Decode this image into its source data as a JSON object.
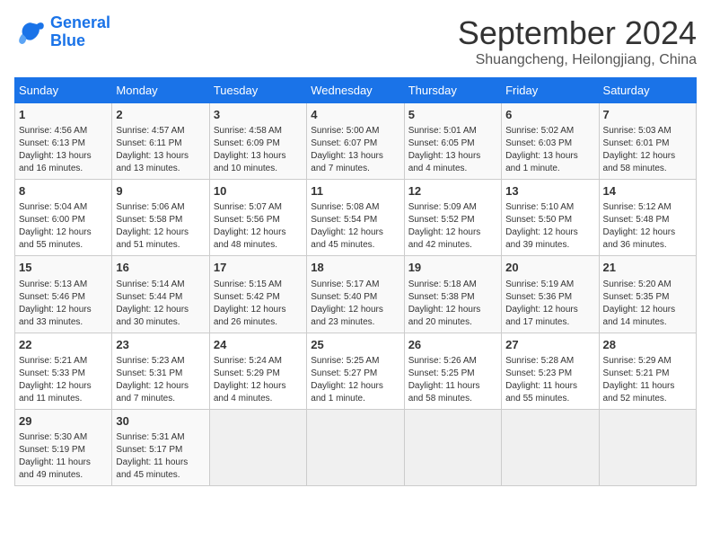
{
  "logo": {
    "line1": "General",
    "line2": "Blue"
  },
  "title": "September 2024",
  "subtitle": "Shuangcheng, Heilongjiang, China",
  "weekdays": [
    "Sunday",
    "Monday",
    "Tuesday",
    "Wednesday",
    "Thursday",
    "Friday",
    "Saturday"
  ],
  "weeks": [
    [
      {
        "day": "1",
        "info": "Sunrise: 4:56 AM\nSunset: 6:13 PM\nDaylight: 13 hours\nand 16 minutes."
      },
      {
        "day": "2",
        "info": "Sunrise: 4:57 AM\nSunset: 6:11 PM\nDaylight: 13 hours\nand 13 minutes."
      },
      {
        "day": "3",
        "info": "Sunrise: 4:58 AM\nSunset: 6:09 PM\nDaylight: 13 hours\nand 10 minutes."
      },
      {
        "day": "4",
        "info": "Sunrise: 5:00 AM\nSunset: 6:07 PM\nDaylight: 13 hours\nand 7 minutes."
      },
      {
        "day": "5",
        "info": "Sunrise: 5:01 AM\nSunset: 6:05 PM\nDaylight: 13 hours\nand 4 minutes."
      },
      {
        "day": "6",
        "info": "Sunrise: 5:02 AM\nSunset: 6:03 PM\nDaylight: 13 hours\nand 1 minute."
      },
      {
        "day": "7",
        "info": "Sunrise: 5:03 AM\nSunset: 6:01 PM\nDaylight: 12 hours\nand 58 minutes."
      }
    ],
    [
      {
        "day": "8",
        "info": "Sunrise: 5:04 AM\nSunset: 6:00 PM\nDaylight: 12 hours\nand 55 minutes."
      },
      {
        "day": "9",
        "info": "Sunrise: 5:06 AM\nSunset: 5:58 PM\nDaylight: 12 hours\nand 51 minutes."
      },
      {
        "day": "10",
        "info": "Sunrise: 5:07 AM\nSunset: 5:56 PM\nDaylight: 12 hours\nand 48 minutes."
      },
      {
        "day": "11",
        "info": "Sunrise: 5:08 AM\nSunset: 5:54 PM\nDaylight: 12 hours\nand 45 minutes."
      },
      {
        "day": "12",
        "info": "Sunrise: 5:09 AM\nSunset: 5:52 PM\nDaylight: 12 hours\nand 42 minutes."
      },
      {
        "day": "13",
        "info": "Sunrise: 5:10 AM\nSunset: 5:50 PM\nDaylight: 12 hours\nand 39 minutes."
      },
      {
        "day": "14",
        "info": "Sunrise: 5:12 AM\nSunset: 5:48 PM\nDaylight: 12 hours\nand 36 minutes."
      }
    ],
    [
      {
        "day": "15",
        "info": "Sunrise: 5:13 AM\nSunset: 5:46 PM\nDaylight: 12 hours\nand 33 minutes."
      },
      {
        "day": "16",
        "info": "Sunrise: 5:14 AM\nSunset: 5:44 PM\nDaylight: 12 hours\nand 30 minutes."
      },
      {
        "day": "17",
        "info": "Sunrise: 5:15 AM\nSunset: 5:42 PM\nDaylight: 12 hours\nand 26 minutes."
      },
      {
        "day": "18",
        "info": "Sunrise: 5:17 AM\nSunset: 5:40 PM\nDaylight: 12 hours\nand 23 minutes."
      },
      {
        "day": "19",
        "info": "Sunrise: 5:18 AM\nSunset: 5:38 PM\nDaylight: 12 hours\nand 20 minutes."
      },
      {
        "day": "20",
        "info": "Sunrise: 5:19 AM\nSunset: 5:36 PM\nDaylight: 12 hours\nand 17 minutes."
      },
      {
        "day": "21",
        "info": "Sunrise: 5:20 AM\nSunset: 5:35 PM\nDaylight: 12 hours\nand 14 minutes."
      }
    ],
    [
      {
        "day": "22",
        "info": "Sunrise: 5:21 AM\nSunset: 5:33 PM\nDaylight: 12 hours\nand 11 minutes."
      },
      {
        "day": "23",
        "info": "Sunrise: 5:23 AM\nSunset: 5:31 PM\nDaylight: 12 hours\nand 7 minutes."
      },
      {
        "day": "24",
        "info": "Sunrise: 5:24 AM\nSunset: 5:29 PM\nDaylight: 12 hours\nand 4 minutes."
      },
      {
        "day": "25",
        "info": "Sunrise: 5:25 AM\nSunset: 5:27 PM\nDaylight: 12 hours\nand 1 minute."
      },
      {
        "day": "26",
        "info": "Sunrise: 5:26 AM\nSunset: 5:25 PM\nDaylight: 11 hours\nand 58 minutes."
      },
      {
        "day": "27",
        "info": "Sunrise: 5:28 AM\nSunset: 5:23 PM\nDaylight: 11 hours\nand 55 minutes."
      },
      {
        "day": "28",
        "info": "Sunrise: 5:29 AM\nSunset: 5:21 PM\nDaylight: 11 hours\nand 52 minutes."
      }
    ],
    [
      {
        "day": "29",
        "info": "Sunrise: 5:30 AM\nSunset: 5:19 PM\nDaylight: 11 hours\nand 49 minutes."
      },
      {
        "day": "30",
        "info": "Sunrise: 5:31 AM\nSunset: 5:17 PM\nDaylight: 11 hours\nand 45 minutes."
      },
      {
        "day": "",
        "info": ""
      },
      {
        "day": "",
        "info": ""
      },
      {
        "day": "",
        "info": ""
      },
      {
        "day": "",
        "info": ""
      },
      {
        "day": "",
        "info": ""
      }
    ]
  ]
}
